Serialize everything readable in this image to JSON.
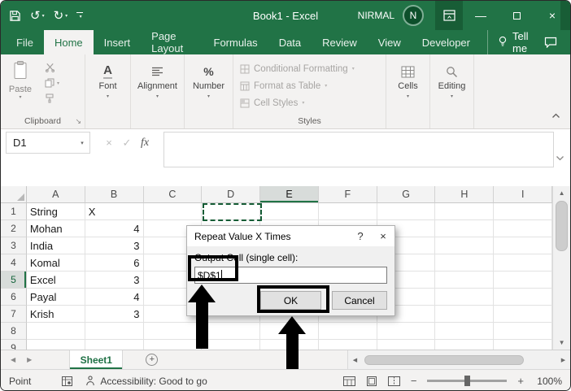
{
  "window": {
    "title": "Book1 - Excel",
    "user_name": "NIRMAL",
    "avatar_initial": "N"
  },
  "icons": {
    "undo": "↺",
    "redo": "↻",
    "caret_down": "▾",
    "cancel_entry": "×",
    "confirm_entry": "✓",
    "close": "×",
    "minimize": "—",
    "nav_left": "◀",
    "nav_right": "▶",
    "scroll_up": "▲",
    "scroll_down": "▼",
    "dialog_launcher": "↘",
    "font_a": "A",
    "percent": "%",
    "zoom_out": "−",
    "zoom_in": "+"
  },
  "ribbon": {
    "tabs": [
      "File",
      "Home",
      "Insert",
      "Page Layout",
      "Formulas",
      "Data",
      "Review",
      "View",
      "Developer"
    ],
    "active_tab": "Home",
    "tell_me_label": "Tell me",
    "paste_label": "Paste",
    "clipboard_group_label": "Clipboard",
    "font_label": "Font",
    "alignment_label": "Alignment",
    "number_label": "Number",
    "styles_items": [
      "Conditional Formatting",
      "Format as Table",
      "Cell Styles"
    ],
    "styles_group_label": "Styles",
    "cells_label": "Cells",
    "editing_label": "Editing"
  },
  "formula_bar": {
    "name_box_value": "D1",
    "fx_label": "fx",
    "formula_value": ""
  },
  "grid": {
    "columns": [
      "A",
      "B",
      "C",
      "D",
      "E",
      "F",
      "G",
      "H",
      "I"
    ],
    "highlighted_column": "E",
    "highlighted_row": "5",
    "ants_cell": "D1",
    "rows": [
      {
        "n": "1",
        "cells": [
          "String",
          "X",
          "",
          "",
          "",
          "",
          "",
          "",
          ""
        ]
      },
      {
        "n": "2",
        "cells": [
          "Mohan",
          "4",
          "",
          "",
          "",
          "",
          "",
          "",
          ""
        ]
      },
      {
        "n": "3",
        "cells": [
          "India",
          "3",
          "",
          "",
          "",
          "",
          "",
          "",
          ""
        ]
      },
      {
        "n": "4",
        "cells": [
          "Komal",
          "6",
          "",
          "",
          "",
          "",
          "",
          "",
          ""
        ]
      },
      {
        "n": "5",
        "cells": [
          "Excel",
          "3",
          "",
          "",
          "",
          "",
          "",
          "",
          ""
        ]
      },
      {
        "n": "6",
        "cells": [
          "Payal",
          "4",
          "",
          "",
          "",
          "",
          "",
          "",
          ""
        ]
      },
      {
        "n": "7",
        "cells": [
          "Krish",
          "3",
          "",
          "",
          "",
          "",
          "",
          "",
          ""
        ]
      },
      {
        "n": "8",
        "cells": [
          "",
          "",
          "",
          "",
          "",
          "",
          "",
          "",
          ""
        ]
      },
      {
        "n": "9",
        "cells": [
          "",
          "",
          "",
          "",
          "",
          "",
          "",
          "",
          ""
        ]
      }
    ]
  },
  "dialog": {
    "title": "Repeat Value X Times",
    "help_label": "?",
    "field_label": "Output Cell (single cell):",
    "field_value": "$D$1",
    "ok_label": "OK",
    "cancel_label": "Cancel"
  },
  "sheet_bar": {
    "active_sheet": "Sheet1",
    "add_sheet": "+"
  },
  "status_bar": {
    "mode": "Point",
    "accessibility_text": "Accessibility: Good to go",
    "zoom_level": "100%"
  },
  "colors": {
    "excel_green": "#217346",
    "title_bar": "#217346",
    "selection_highlight": "#d8dcda",
    "annotation": "#000000"
  }
}
